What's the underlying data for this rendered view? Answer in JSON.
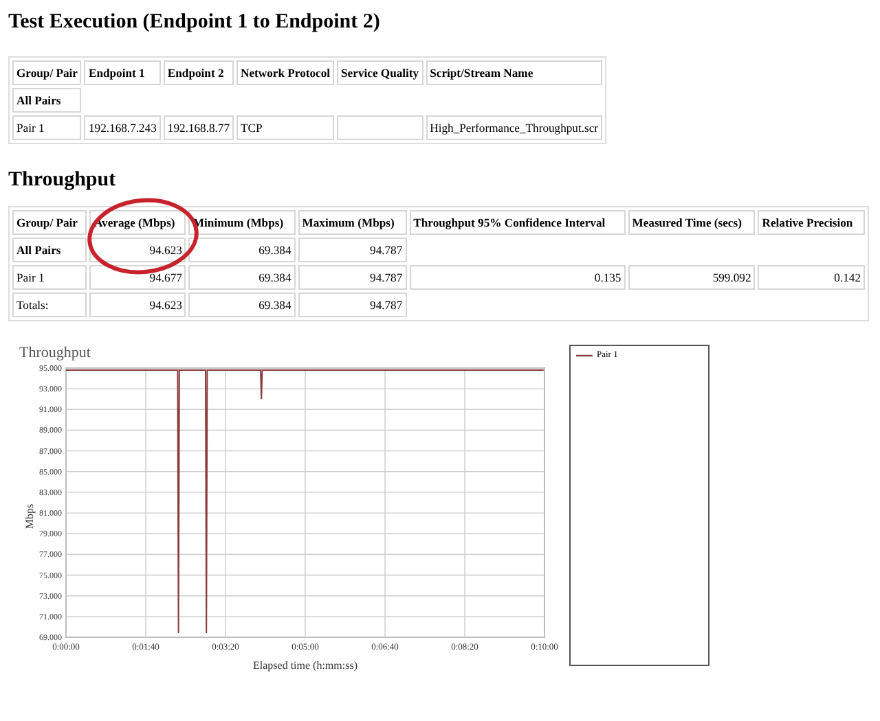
{
  "title": "Test Execution (Endpoint 1 to Endpoint 2)",
  "pairs_table": {
    "columns": [
      "Group/ Pair",
      "Endpoint 1",
      "Endpoint 2",
      "Network Protocol",
      "Service Quality",
      "Script/Stream Name"
    ],
    "rows": [
      {
        "kind": "group",
        "cells": [
          "All Pairs"
        ]
      },
      {
        "kind": "pair",
        "cells": [
          "Pair 1",
          "192.168.7.243",
          "192.168.8.77",
          "TCP",
          "",
          "High_Performance_Throughput.scr"
        ]
      }
    ]
  },
  "throughput_heading": "Throughput",
  "throughput_table": {
    "columns": [
      "Group/ Pair",
      "Average (Mbps)",
      "Minimum (Mbps)",
      "Maximum (Mbps)",
      "Throughput 95% Confidence Interval",
      "Measured Time (secs)",
      "Relative Precision"
    ],
    "rows": [
      {
        "kind": "group",
        "cells": [
          "All Pairs",
          "94.623",
          "69.384",
          "94.787"
        ]
      },
      {
        "kind": "pair",
        "cells": [
          "Pair 1",
          "94.677",
          "69.384",
          "94.787",
          "0.135",
          "599.092",
          "0.142"
        ]
      },
      {
        "kind": "total",
        "cells": [
          "Totals:",
          "94.623",
          "69.384",
          "94.787"
        ]
      }
    ]
  },
  "chart": {
    "chart_data": {
      "type": "line",
      "title": "Throughput",
      "xlabel": "Elapsed time (h:mm:ss)",
      "ylabel": "Mbps",
      "x": [
        0,
        140,
        141,
        142,
        175,
        176,
        177,
        244,
        245,
        246,
        599
      ],
      "series": [
        {
          "name": "Pair 1",
          "color": "#8b3a3a",
          "values": [
            94.8,
            94.8,
            69.4,
            94.8,
            94.8,
            69.4,
            94.8,
            94.8,
            92.0,
            94.8,
            94.8
          ]
        }
      ],
      "grid": true,
      "xlim": [
        0,
        600
      ],
      "ylim": [
        69,
        95
      ],
      "xticks": [
        {
          "value": 0,
          "label": "0:00:00"
        },
        {
          "value": 100,
          "label": "0:01:40"
        },
        {
          "value": 200,
          "label": "0:03:20"
        },
        {
          "value": 300,
          "label": "0:05:00"
        },
        {
          "value": 400,
          "label": "0:06:40"
        },
        {
          "value": 500,
          "label": "0:08:20"
        },
        {
          "value": 600,
          "label": "0:10:00"
        }
      ],
      "yticks": [
        {
          "value": 69,
          "label": "69.000"
        },
        {
          "value": 71,
          "label": "71.000"
        },
        {
          "value": 73,
          "label": "73.000"
        },
        {
          "value": 75,
          "label": "75.000"
        },
        {
          "value": 77,
          "label": "77.000"
        },
        {
          "value": 79,
          "label": "79.000"
        },
        {
          "value": 81,
          "label": "81.000"
        },
        {
          "value": 83,
          "label": "83.000"
        },
        {
          "value": 85,
          "label": "85.000"
        },
        {
          "value": 87,
          "label": "87.000"
        },
        {
          "value": 89,
          "label": "89.000"
        },
        {
          "value": 91,
          "label": "91.000"
        },
        {
          "value": 93,
          "label": "93.000"
        },
        {
          "value": 95,
          "label": "95.000"
        }
      ]
    }
  }
}
